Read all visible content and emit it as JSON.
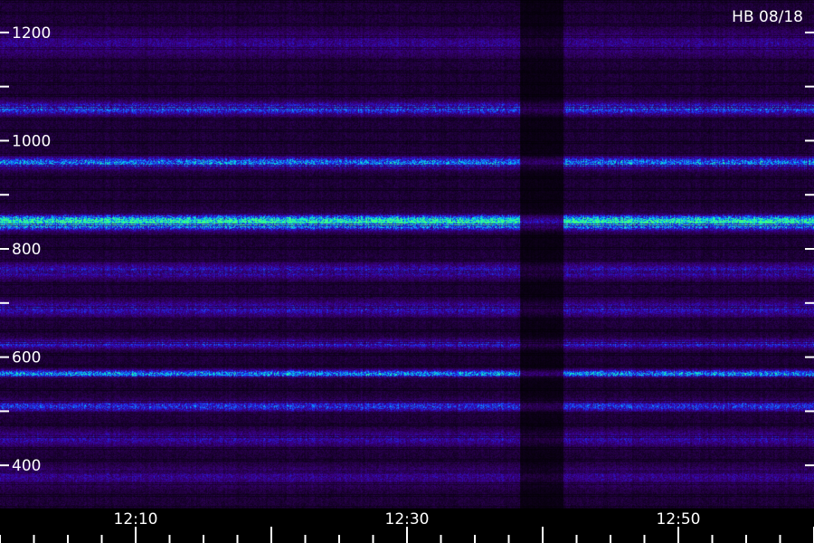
{
  "chart_data": {
    "type": "heatmap",
    "title": "",
    "xlabel": "",
    "ylabel": "",
    "corner_label": "HB 08/18",
    "x_axis": {
      "range": [
        "12:00",
        "13:00"
      ],
      "range_minutes": [
        0,
        60
      ],
      "tick_labels": [
        {
          "value": 10,
          "label": "12:10"
        },
        {
          "value": 30,
          "label": "12:30"
        },
        {
          "value": 50,
          "label": "12:50"
        }
      ],
      "major_ticks": [
        10,
        30,
        50
      ],
      "minor_ticks": [
        0,
        2.5,
        5,
        7.5,
        12.5,
        15,
        17.5,
        20,
        22.5,
        25,
        27.5,
        32.5,
        35,
        37.5,
        40,
        42.5,
        45,
        47.5,
        52.5,
        55,
        57.5
      ],
      "mid_ticks": [
        20,
        40,
        60
      ]
    },
    "y_axis": {
      "range": [
        320,
        1260
      ],
      "ticks": [
        400,
        500,
        600,
        700,
        800,
        900,
        1000,
        1100,
        1200
      ],
      "tick_labels": [
        {
          "value": 1200,
          "label": "1200"
        },
        {
          "value": 1000,
          "label": "1000"
        },
        {
          "value": 800,
          "label": "800"
        },
        {
          "value": 600,
          "label": "600"
        },
        {
          "value": 400,
          "label": "400"
        }
      ]
    },
    "bands": [
      {
        "center": 850,
        "width": 22,
        "intensity": 0.95
      },
      {
        "center": 960,
        "width": 18,
        "intensity": 0.55
      },
      {
        "center": 1060,
        "width": 20,
        "intensity": 0.45
      },
      {
        "center": 570,
        "width": 12,
        "intensity": 0.6
      },
      {
        "center": 625,
        "width": 15,
        "intensity": 0.35
      },
      {
        "center": 510,
        "width": 18,
        "intensity": 0.4
      },
      {
        "center": 690,
        "width": 25,
        "intensity": 0.3
      },
      {
        "center": 760,
        "width": 25,
        "intensity": 0.3
      },
      {
        "center": 450,
        "width": 25,
        "intensity": 0.25
      },
      {
        "center": 380,
        "width": 30,
        "intensity": 0.2
      },
      {
        "center": 1180,
        "width": 40,
        "intensity": 0.2
      }
    ],
    "dark_gap_minutes": [
      38.3,
      41.5
    ],
    "colormap": [
      "#000000",
      "#2a0050",
      "#3a0090",
      "#2020e0",
      "#1080ff",
      "#00e0e0",
      "#40ff80"
    ],
    "grid": false,
    "legend": "none"
  }
}
